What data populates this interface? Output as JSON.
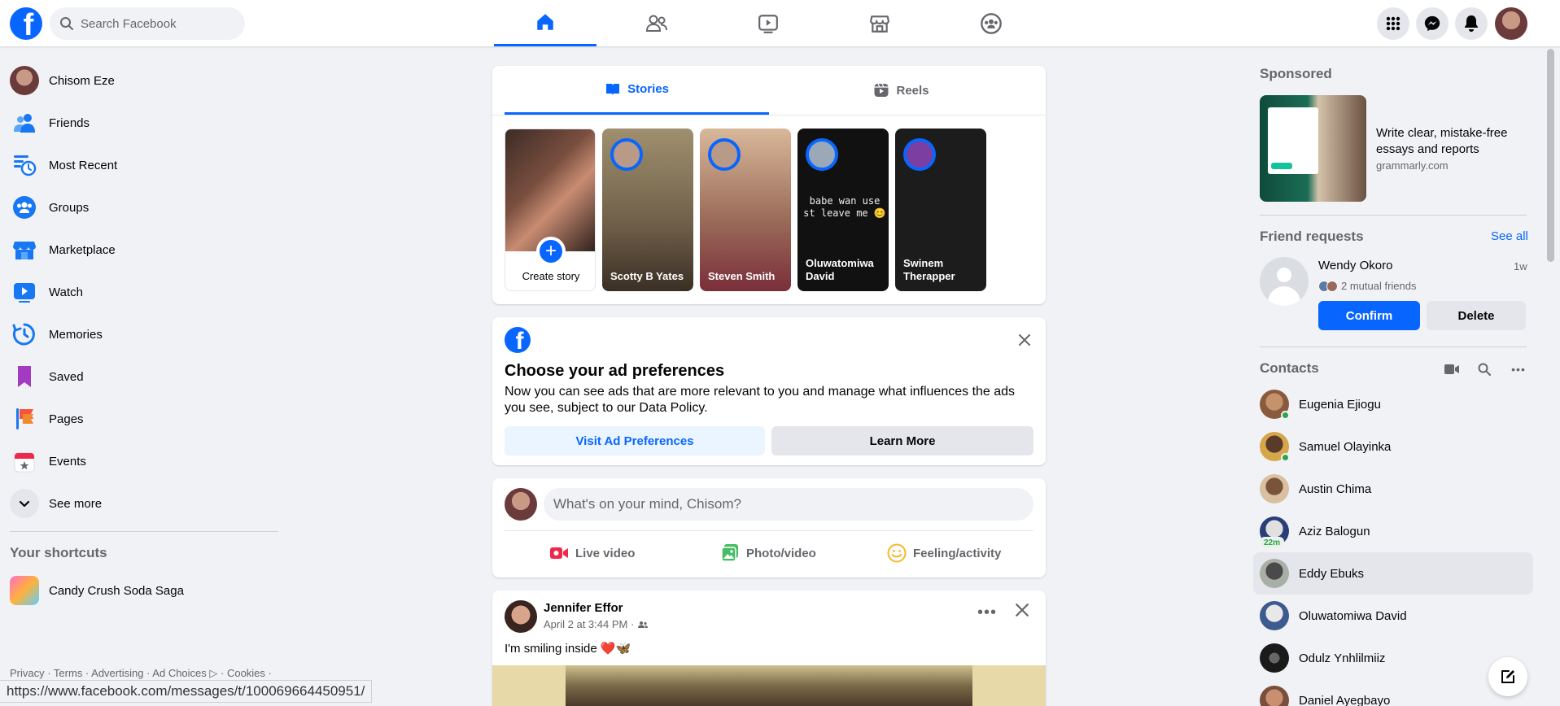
{
  "header": {
    "logo": "f",
    "search_placeholder": "Search Facebook",
    "nav_tabs": [
      "home-icon",
      "friends-icon",
      "watch-icon",
      "marketplace-icon",
      "groups-icon"
    ],
    "right_icons": [
      "menu-grid-icon",
      "messenger-icon",
      "notifications-icon",
      "profile-avatar"
    ],
    "accent": "#0866ff"
  },
  "left_nav": {
    "items": [
      {
        "label": "Chisom Eze",
        "icon": "profile-avatar"
      },
      {
        "label": "Friends",
        "icon": "friends-icon"
      },
      {
        "label": "Most Recent",
        "icon": "most-recent-icon"
      },
      {
        "label": "Groups",
        "icon": "groups-icon"
      },
      {
        "label": "Marketplace",
        "icon": "marketplace-icon"
      },
      {
        "label": "Watch",
        "icon": "watch-icon"
      },
      {
        "label": "Memories",
        "icon": "memories-icon"
      },
      {
        "label": "Saved",
        "icon": "saved-icon"
      },
      {
        "label": "Pages",
        "icon": "pages-icon"
      },
      {
        "label": "Events",
        "icon": "events-icon"
      },
      {
        "label": "See more",
        "icon": "chevron-down-icon"
      }
    ],
    "shortcuts_title": "Your shortcuts",
    "shortcuts": [
      {
        "label": "Candy Crush Soda Saga",
        "icon": "candy-crush-icon"
      }
    ],
    "footer": "Privacy · Terms · Advertising · Ad Choices ▷ · Cookies ·"
  },
  "status_url": "https://www.facebook.com/messages/t/100069664450951/",
  "stories": {
    "tabs": [
      "Stories",
      "Reels"
    ],
    "create_label": "Create story",
    "items": [
      {
        "name": "Scotty B Yates",
        "bg": "#8a7a64"
      },
      {
        "name": "Steven Smith",
        "bg": "#9a5a4a"
      },
      {
        "name": "Oluwatomiwa David",
        "bg": "#111111",
        "text": "babe wan use st leave me 😊"
      },
      {
        "name": "Swinem Therapper",
        "bg": "#1c1c1c"
      }
    ]
  },
  "ad_prefs": {
    "title": "Choose your ad preferences",
    "body": "Now you can see ads that are more relevant to you and manage what influences the ads you see, subject to our Data Policy.",
    "visit_label": "Visit Ad Preferences",
    "learn_label": "Learn More"
  },
  "composer": {
    "placeholder": "What's on your mind, Chisom?",
    "actions": [
      "Live video",
      "Photo/video",
      "Feeling/activity"
    ]
  },
  "post": {
    "author": "Jennifer Effor",
    "time": "April 2 at 3:44 PM ·",
    "text": "I'm smiling inside ❤️🦋"
  },
  "right": {
    "sponsored_title": "Sponsored",
    "ad_text": "Write clear, mistake-free essays and reports",
    "ad_url": "grammarly.com",
    "friend_requests_title": "Friend requests",
    "see_all": "See all",
    "request": {
      "name": "Wendy Okoro",
      "time": "1w",
      "mutual": "2 mutual friends",
      "confirm": "Confirm",
      "delete": "Delete"
    },
    "contacts_title": "Contacts",
    "contacts": [
      {
        "name": "Eugenia Ejiogu",
        "online": true,
        "color": "#8a5a3c"
      },
      {
        "name": "Samuel Olayinka",
        "online": true,
        "color": "#d6a64a"
      },
      {
        "name": "Austin Chima",
        "online": false,
        "color": "#6b4a32"
      },
      {
        "name": "Aziz Balogun",
        "online": false,
        "badge": "22m",
        "color": "#2a3f78"
      },
      {
        "name": "Eddy Ebuks",
        "online": false,
        "color": "#6d7a6b"
      },
      {
        "name": "Oluwatomiwa David",
        "online": false,
        "color": "#3d5b8f"
      },
      {
        "name": "Odulz Ynhlilmiiz",
        "online": false,
        "color": "#1a1a1a"
      },
      {
        "name": "Daniel Ayegbayo",
        "online": false,
        "color": "#7a4e3c"
      }
    ]
  }
}
